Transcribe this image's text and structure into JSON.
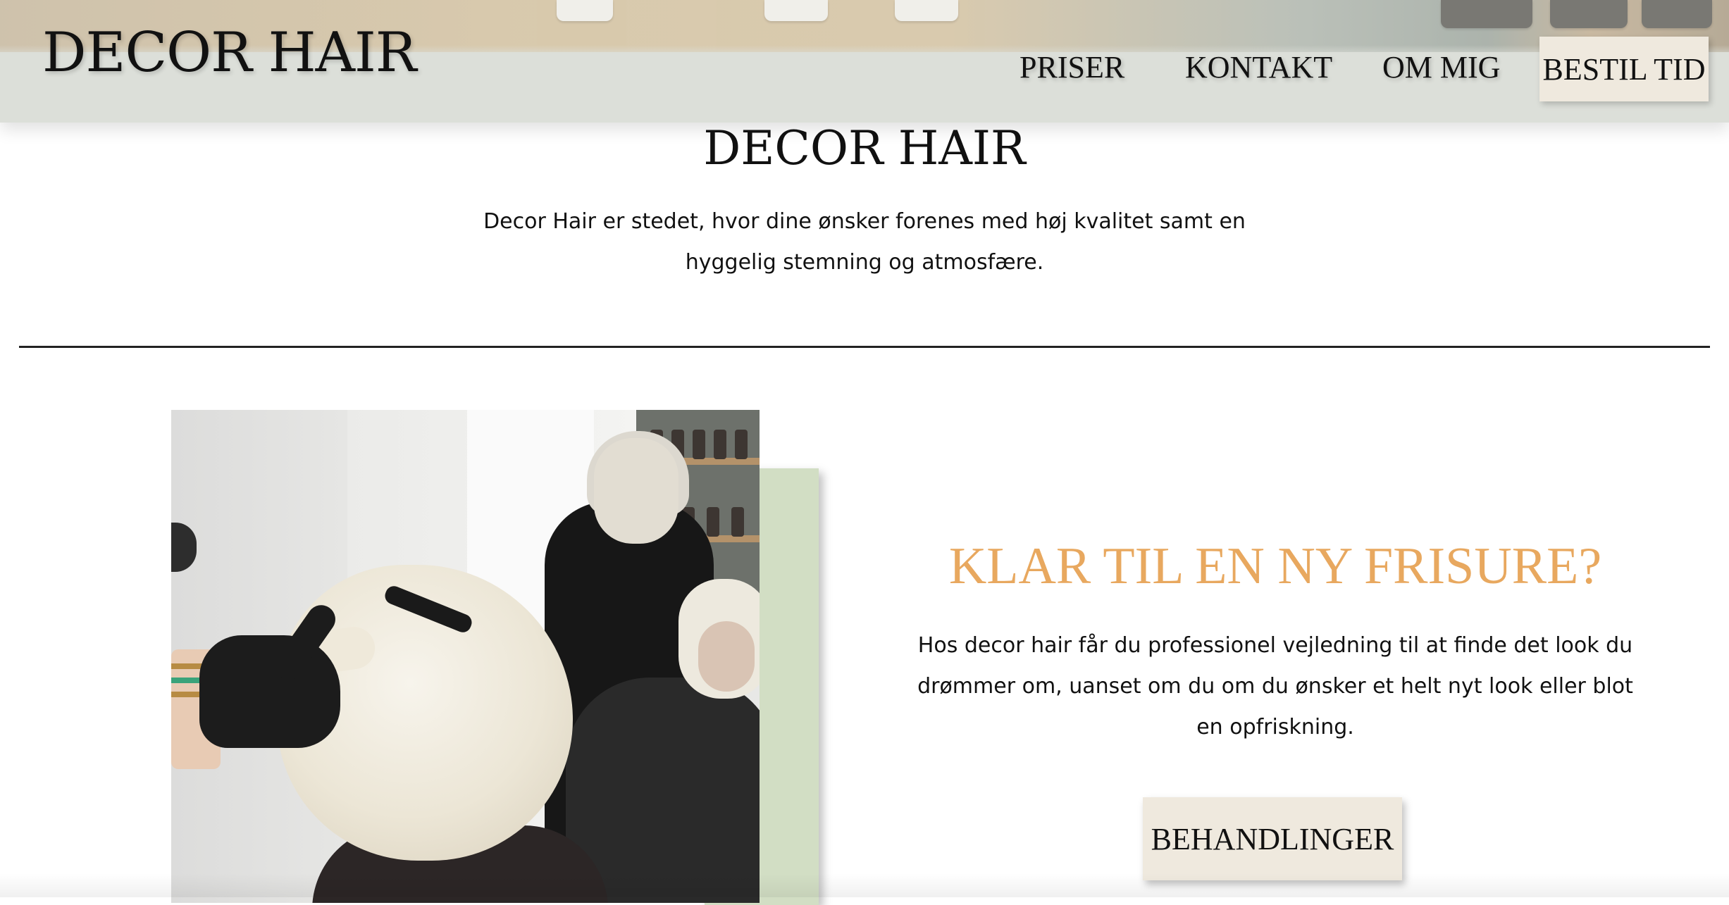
{
  "header": {
    "logo": "DECOR HAIR",
    "nav": [
      {
        "label": "PRISER"
      },
      {
        "label": "KONTAKT"
      },
      {
        "label": "OM MIG"
      }
    ],
    "book_button": "BESTIL TID"
  },
  "intro": {
    "title": "DECOR HAIR",
    "text": "Decor Hair er stedet, hvor dine ønsker forenes med høj kvalitet samt en hyggelig stemning og atmosfære."
  },
  "feature": {
    "image_alt_icon": "salon-photo",
    "title": "KLAR TIL EN NY FRISURE?",
    "text": "Hos decor hair får du professionel vejledning til at finde det look du drømmer om, uanset om du om du ønsker et helt nyt look eller blot en opfriskning.",
    "button": "BEHANDLINGER"
  },
  "colors": {
    "accent": "#e8a85f",
    "button_bg": "#efe9de",
    "card_green": "#d2dec4",
    "header_bg": "#dcdfd9"
  }
}
